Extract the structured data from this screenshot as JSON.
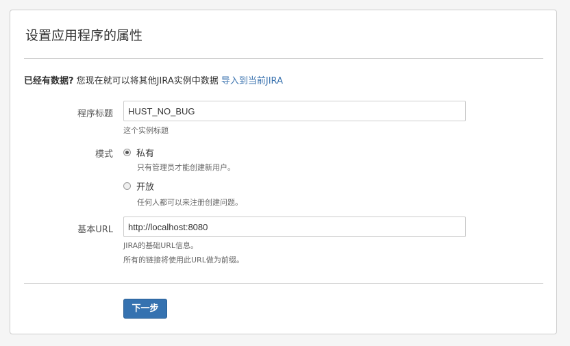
{
  "page": {
    "title": "设置应用程序的属性"
  },
  "import": {
    "question": "已经有数据?",
    "text": " 您现在就可以将其他JIRA实例中数据 ",
    "link": "导入到当前JIRA"
  },
  "form": {
    "app_title": {
      "label": "程序标题",
      "value": "HUST_NO_BUG",
      "help": "这个实例标题"
    },
    "mode": {
      "label": "模式",
      "selected": "private",
      "options": [
        {
          "label": "私有",
          "help": "只有管理员才能创建新用户。"
        },
        {
          "label": "开放",
          "help": "任何人都可以来注册创建问题。"
        }
      ]
    },
    "base_url": {
      "label": "基本URL",
      "value": "http://localhost:8080",
      "help_line1": "JIRA的基础URL信息。",
      "help_line2": "所有的链接将使用此URL做为前缀。"
    }
  },
  "actions": {
    "next_label": "下一步"
  },
  "colors": {
    "primary_button": "#3572b0",
    "link": "#3b73af"
  }
}
